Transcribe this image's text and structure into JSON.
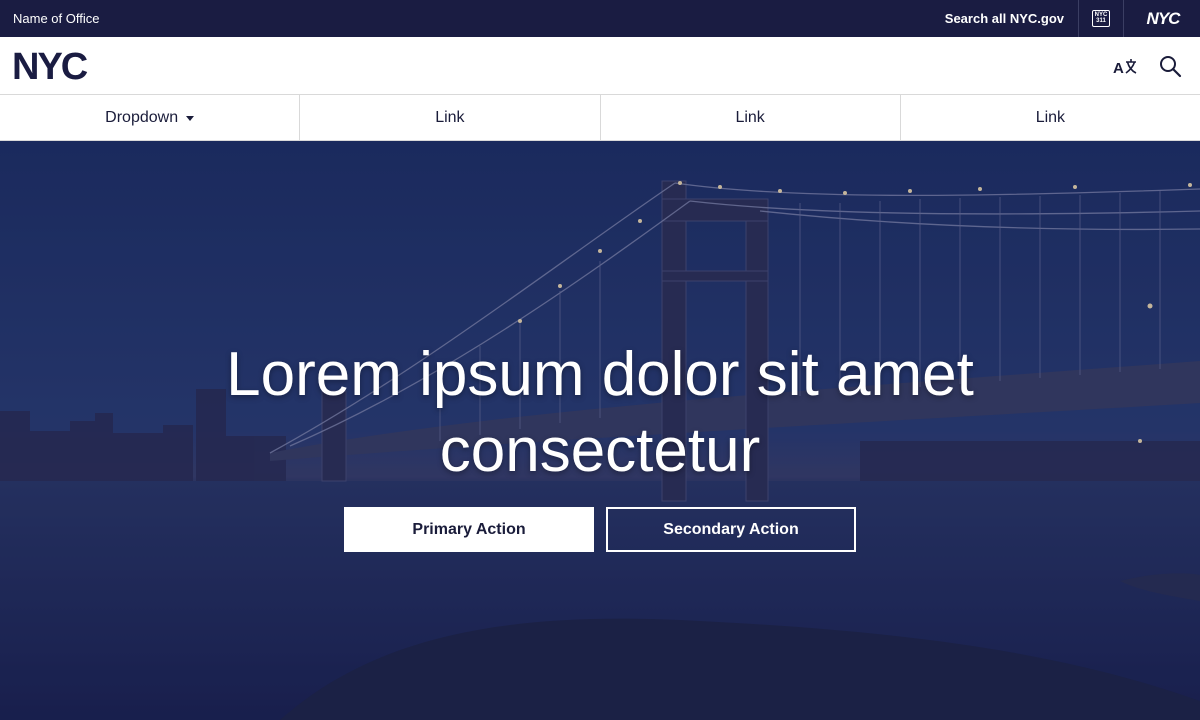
{
  "utility_bar": {
    "office_name": "Name of Office",
    "search_label": "Search all NYC.gov",
    "icon_311": "NYC 311",
    "logo_text": "NYC"
  },
  "header": {
    "logo_text": "NYC",
    "translate_icon": "translate-icon",
    "search_icon": "search-icon"
  },
  "nav": {
    "items": [
      {
        "label": "Dropdown",
        "has_dropdown": true
      },
      {
        "label": "Link"
      },
      {
        "label": "Link"
      },
      {
        "label": "Link"
      }
    ]
  },
  "hero": {
    "title_line1": "Lorem ipsum dolor sit amet",
    "title_line2": "consectetur",
    "primary_action": "Primary Action",
    "secondary_action": "Secondary Action"
  },
  "colors": {
    "brand_navy": "#1a1c42",
    "white": "#ffffff",
    "nav_text": "#1a1c3a"
  }
}
